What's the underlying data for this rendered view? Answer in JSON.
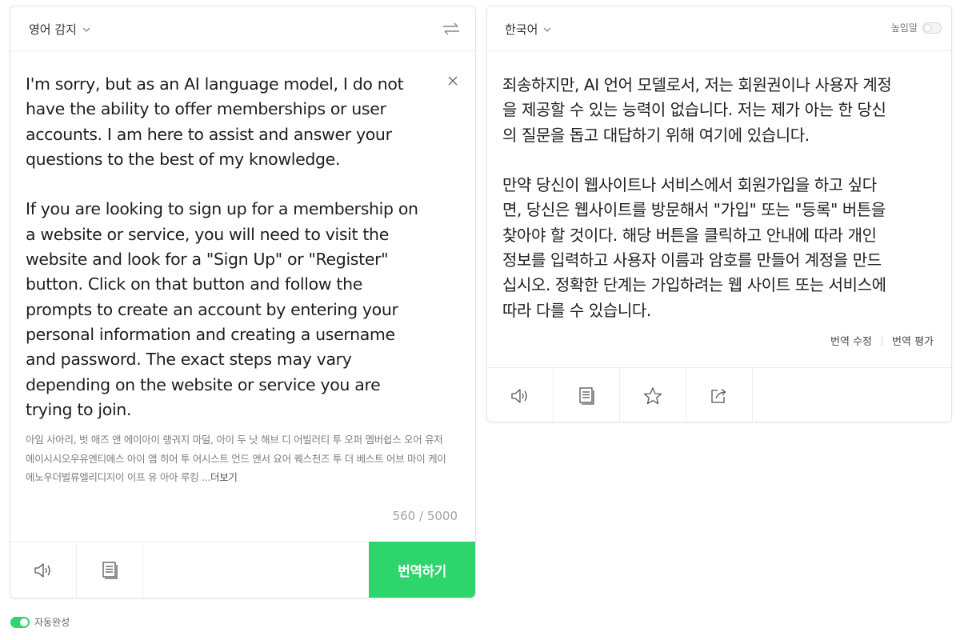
{
  "source": {
    "language_label": "영어 감지",
    "text": "I'm sorry, but as an AI language model, I do not\nhave the ability to offer memberships or user\naccounts. I am here to assist and answer your\nquestions to the best of my knowledge.\n\nIf you are looking to sign up for a membership on\na website or service, you will need to visit the\nwebsite and look for a \"Sign Up\" or \"Register\"\nbutton. Click on that button and follow the\nprompts to create an account by entering your\npersonal information and creating a username\nand password. The exact steps may vary\ndepending on the website or service you are\ntrying to join.",
    "pronunciation": "아임 사아리, 벗 애즈 앤 에이아이 랭궈지 마덜, 아이 두 낫 해브 디 어빌러티 투 오퍼 멤버쉽스 오어 유저 에이시시오우유엔티에스 아이 앰 히어 투 어시스트 언드 앤서 요어 퀘스천즈 투 더 베스트 어브 마이 케이에노우더벌류엘리디지이 이프 유 아아 루킹 ...",
    "more_label": "더보기",
    "char_count": "560 / 5000",
    "translate_button": "번역하기"
  },
  "target": {
    "language_label": "한국어",
    "honorific_label": "높임말",
    "text": "죄송하지만, AI 언어 모델로서, 저는 회원권이나 사용자 계정\n을 제공할 수 있는 능력이 없습니다. 저는 제가 아는 한 당신\n의 질문을 돕고 대답하기 위해 여기에 있습니다.\n\n만약 당신이 웹사이트나 서비스에서 회원가입을 하고 싶다\n면, 당신은 웹사이트를 방문해서 \"가입\" 또는 \"등록\" 버튼을\n찾아야 할 것이다. 해당 버튼을 클릭하고 안내에 따라 개인\n정보를 입력하고 사용자 이름과 암호를 만들어 계정을 만드\n십시오. 정확한 단계는 가입하려는 웹 사이트 또는 서비스에\n따라 다를 수 있습니다.",
    "edit_link": "번역 수정",
    "rate_link": "번역 평가"
  },
  "footer": {
    "autocomplete_label": "자동완성"
  },
  "colors": {
    "accent": "#2ed46c",
    "border": "#e3e5e8"
  },
  "icons": {
    "swap": "swap-icon",
    "clear": "close-icon",
    "speaker": "speaker-icon",
    "copy": "copy-icon",
    "star": "star-icon",
    "share": "share-icon"
  }
}
